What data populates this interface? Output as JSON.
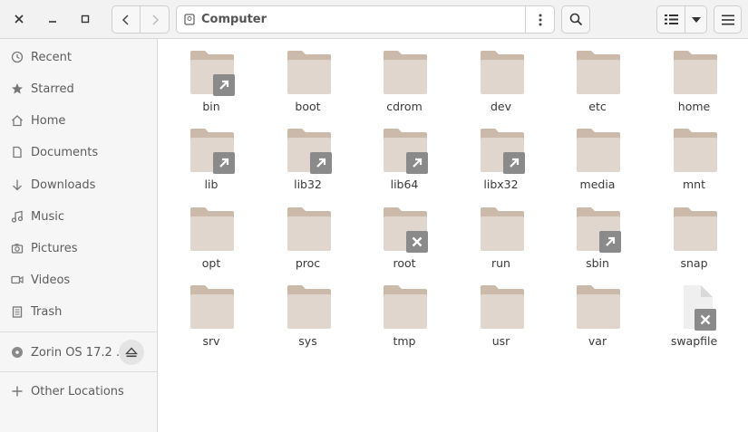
{
  "window": {
    "close_icon": "close-icon",
    "minimize_icon": "minimize-icon",
    "maximize_icon": "maximize-icon"
  },
  "toolbar": {
    "back_icon": "chevron-left-icon",
    "forward_icon": "chevron-right-icon",
    "location_label": "Computer",
    "location_icon": "drive-icon",
    "path_menu_icon": "more-vertical-icon",
    "search_icon": "search-icon",
    "view_icon": "list-view-icon",
    "view_dropdown_icon": "chevron-down-icon",
    "main_menu_icon": "hamburger-icon"
  },
  "sidebar": {
    "items": [
      {
        "label": "Recent",
        "icon": "clock-icon"
      },
      {
        "label": "Starred",
        "icon": "star-icon"
      },
      {
        "label": "Home",
        "icon": "home-icon"
      },
      {
        "label": "Documents",
        "icon": "document-icon"
      },
      {
        "label": "Downloads",
        "icon": "download-icon"
      },
      {
        "label": "Music",
        "icon": "music-icon"
      },
      {
        "label": "Pictures",
        "icon": "camera-icon"
      },
      {
        "label": "Videos",
        "icon": "video-icon"
      },
      {
        "label": "Trash",
        "icon": "trash-icon"
      }
    ],
    "volume": {
      "label": "Zorin OS 17.2 ...",
      "icon": "disc-icon",
      "eject_icon": "eject-icon"
    },
    "other": {
      "label": "Other Locations",
      "icon": "plus-icon"
    }
  },
  "files": [
    {
      "name": "bin",
      "type": "folder",
      "emblem": "symlink"
    },
    {
      "name": "boot",
      "type": "folder",
      "emblem": ""
    },
    {
      "name": "cdrom",
      "type": "folder",
      "emblem": ""
    },
    {
      "name": "dev",
      "type": "folder",
      "emblem": ""
    },
    {
      "name": "etc",
      "type": "folder",
      "emblem": ""
    },
    {
      "name": "home",
      "type": "folder",
      "emblem": ""
    },
    {
      "name": "lib",
      "type": "folder",
      "emblem": "symlink"
    },
    {
      "name": "lib32",
      "type": "folder",
      "emblem": "symlink"
    },
    {
      "name": "lib64",
      "type": "folder",
      "emblem": "symlink"
    },
    {
      "name": "libx32",
      "type": "folder",
      "emblem": "symlink"
    },
    {
      "name": "media",
      "type": "folder",
      "emblem": ""
    },
    {
      "name": "mnt",
      "type": "folder",
      "emblem": ""
    },
    {
      "name": "opt",
      "type": "folder",
      "emblem": ""
    },
    {
      "name": "proc",
      "type": "folder",
      "emblem": ""
    },
    {
      "name": "root",
      "type": "folder",
      "emblem": "unreadable"
    },
    {
      "name": "run",
      "type": "folder",
      "emblem": ""
    },
    {
      "name": "sbin",
      "type": "folder",
      "emblem": "symlink"
    },
    {
      "name": "snap",
      "type": "folder",
      "emblem": ""
    },
    {
      "name": "srv",
      "type": "folder",
      "emblem": ""
    },
    {
      "name": "sys",
      "type": "folder",
      "emblem": ""
    },
    {
      "name": "tmp",
      "type": "folder",
      "emblem": ""
    },
    {
      "name": "usr",
      "type": "folder",
      "emblem": ""
    },
    {
      "name": "var",
      "type": "folder",
      "emblem": ""
    },
    {
      "name": "swapfile",
      "type": "file",
      "emblem": "unreadable"
    }
  ],
  "colors": {
    "folder_back": "#cbb9aa",
    "folder_front": "#e0d6ce",
    "emblem": "#8a8a8a"
  }
}
